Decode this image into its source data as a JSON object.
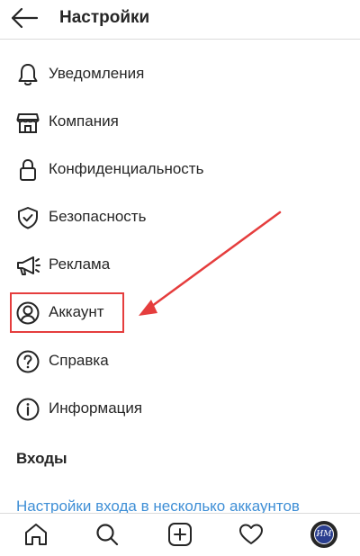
{
  "header": {
    "title": "Настройки",
    "back_icon": "arrow-left-icon"
  },
  "menu": {
    "items": [
      {
        "label": "Уведомления",
        "icon": "bell-icon"
      },
      {
        "label": "Компания",
        "icon": "storefront-icon"
      },
      {
        "label": "Конфиденциальность",
        "icon": "lock-icon"
      },
      {
        "label": "Безопасность",
        "icon": "shield-check-icon"
      },
      {
        "label": "Реклама",
        "icon": "megaphone-icon"
      },
      {
        "label": "Аккаунт",
        "icon": "person-circle-icon"
      },
      {
        "label": "Справка",
        "icon": "question-circle-icon"
      },
      {
        "label": "Информация",
        "icon": "info-circle-icon"
      }
    ]
  },
  "logins": {
    "heading": "Входы",
    "link": "Настройки входа в несколько аккаунтов"
  },
  "tabbar": {
    "items": [
      {
        "icon": "home-icon"
      },
      {
        "icon": "search-icon"
      },
      {
        "icon": "add-post-icon"
      },
      {
        "icon": "heart-icon"
      },
      {
        "icon": "profile-avatar-icon",
        "initials": "ИМ"
      }
    ]
  },
  "colors": {
    "text": "#262626",
    "link": "#3f8fd6",
    "annotation": "#e53d3d",
    "divider": "#dbdbdb"
  }
}
